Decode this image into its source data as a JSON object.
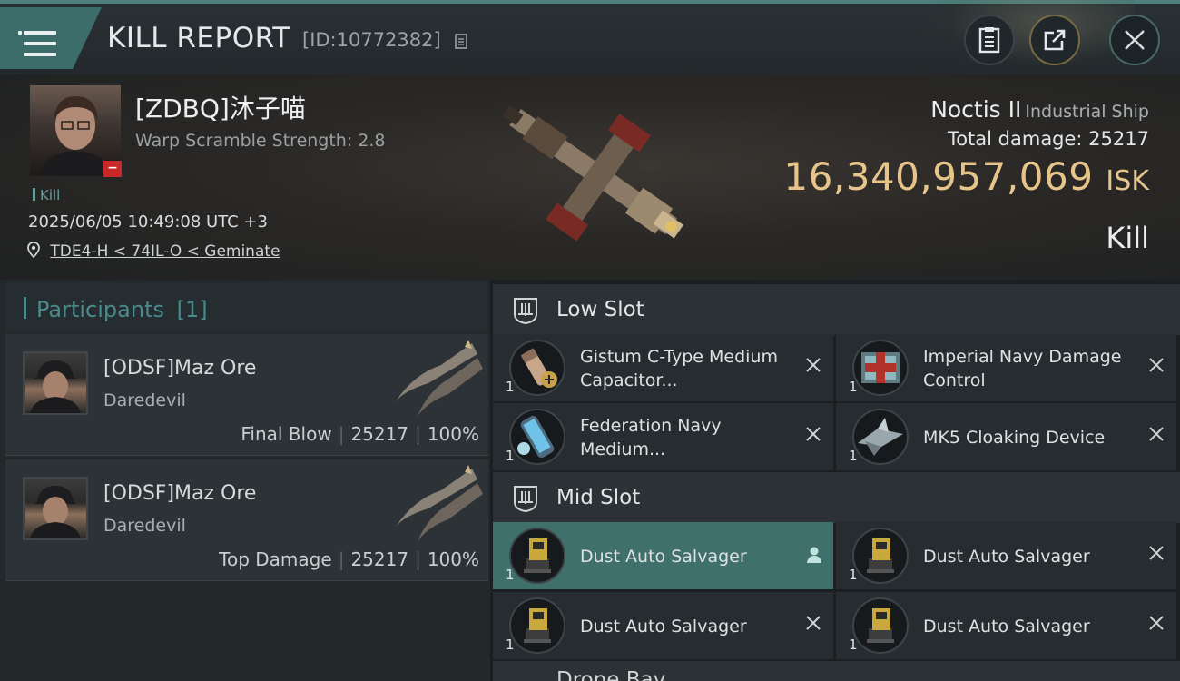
{
  "window": {
    "title": "KILL REPORT",
    "report_id": "[ID:10772382]"
  },
  "victim": {
    "name": "[ZDBQ]沐子喵",
    "warp_scramble": "Warp Scramble Strength: 2.8",
    "tag": "Kill",
    "datetime": "2025/06/05 10:49:08 UTC +3",
    "location": "TDE4-H < 74IL-O < Geminate",
    "ship_name": "Noctis II",
    "ship_class": "Industrial Ship",
    "total_damage": "Total damage:  25217",
    "isk_value": "16,340,957,069",
    "isk_unit": "ISK",
    "result": "Kill"
  },
  "participants": {
    "title": "Participants",
    "count": "[1]",
    "items": [
      {
        "name": "[ODSF]Maz Ore",
        "ship": "Daredevil",
        "role": "Final Blow",
        "damage": "25217",
        "percent": "100%"
      },
      {
        "name": "[ODSF]Maz Ore",
        "ship": "Daredevil",
        "role": "Top Damage",
        "damage": "25217",
        "percent": "100%"
      }
    ]
  },
  "slots": {
    "low": {
      "title": "Low Slot",
      "items": [
        {
          "qty": "1",
          "name": "Gistum C-Type Medium Capacitor...",
          "icon": "capacitor-battery-icon",
          "state": "destroyed"
        },
        {
          "qty": "1",
          "name": "Imperial Navy Damage Control",
          "icon": "damage-control-icon",
          "state": "destroyed"
        },
        {
          "qty": "1",
          "name": "Federation Navy Medium...",
          "icon": "blue-capacitor-icon",
          "state": "destroyed"
        },
        {
          "qty": "1",
          "name": "MK5 Cloaking Device",
          "icon": "cloaking-device-icon",
          "state": "destroyed"
        }
      ]
    },
    "mid": {
      "title": "Mid Slot",
      "items": [
        {
          "qty": "1",
          "name": "Dust Auto Salvager",
          "icon": "salvager-icon",
          "state": "dropped"
        },
        {
          "qty": "1",
          "name": "Dust Auto Salvager",
          "icon": "salvager-icon",
          "state": "destroyed"
        },
        {
          "qty": "1",
          "name": "Dust Auto Salvager",
          "icon": "salvager-icon",
          "state": "destroyed"
        },
        {
          "qty": "1",
          "name": "Dust Auto Salvager",
          "icon": "salvager-icon",
          "state": "destroyed"
        }
      ]
    },
    "next_partial": {
      "title": "Drone Bay"
    }
  },
  "colors": {
    "accent": "#3f706c",
    "isk_gold": "#e7c58a",
    "participants_title": "#4a8a8b",
    "danger_badge": "#c82828"
  }
}
